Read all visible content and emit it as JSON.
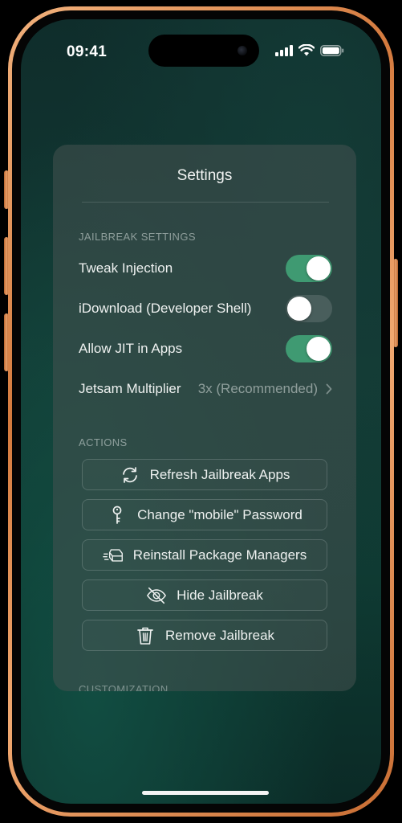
{
  "status_bar": {
    "time": "09:41"
  },
  "settings": {
    "title": "Settings",
    "sections": {
      "jailbreak": {
        "header": "JAILBREAK SETTINGS",
        "rows": [
          {
            "label": "Tweak Injection",
            "type": "toggle",
            "enabled": true
          },
          {
            "label": "iDownload (Developer Shell)",
            "type": "toggle",
            "enabled": false
          },
          {
            "label": "Allow JIT in Apps",
            "type": "toggle",
            "enabled": true
          },
          {
            "label": "Jetsam Multiplier",
            "type": "disclosure",
            "value": "3x (Recommended)"
          }
        ]
      },
      "actions": {
        "header": "ACTIONS",
        "buttons": [
          {
            "label": "Refresh Jailbreak Apps",
            "icon": "refresh-icon"
          },
          {
            "label": "Change \"mobile\" Password",
            "icon": "key-icon"
          },
          {
            "label": "Reinstall Package Managers",
            "icon": "package-icon"
          },
          {
            "label": "Hide Jailbreak",
            "icon": "eye-slash-icon"
          },
          {
            "label": "Remove Jailbreak",
            "icon": "trash-icon"
          }
        ]
      },
      "customization": {
        "header": "CUSTOMIZATION"
      }
    }
  },
  "colors": {
    "toggle_on": "#3f9a72",
    "toggle_off": "#3c4544",
    "frame": "#e08a4c",
    "background": "#133b35"
  }
}
